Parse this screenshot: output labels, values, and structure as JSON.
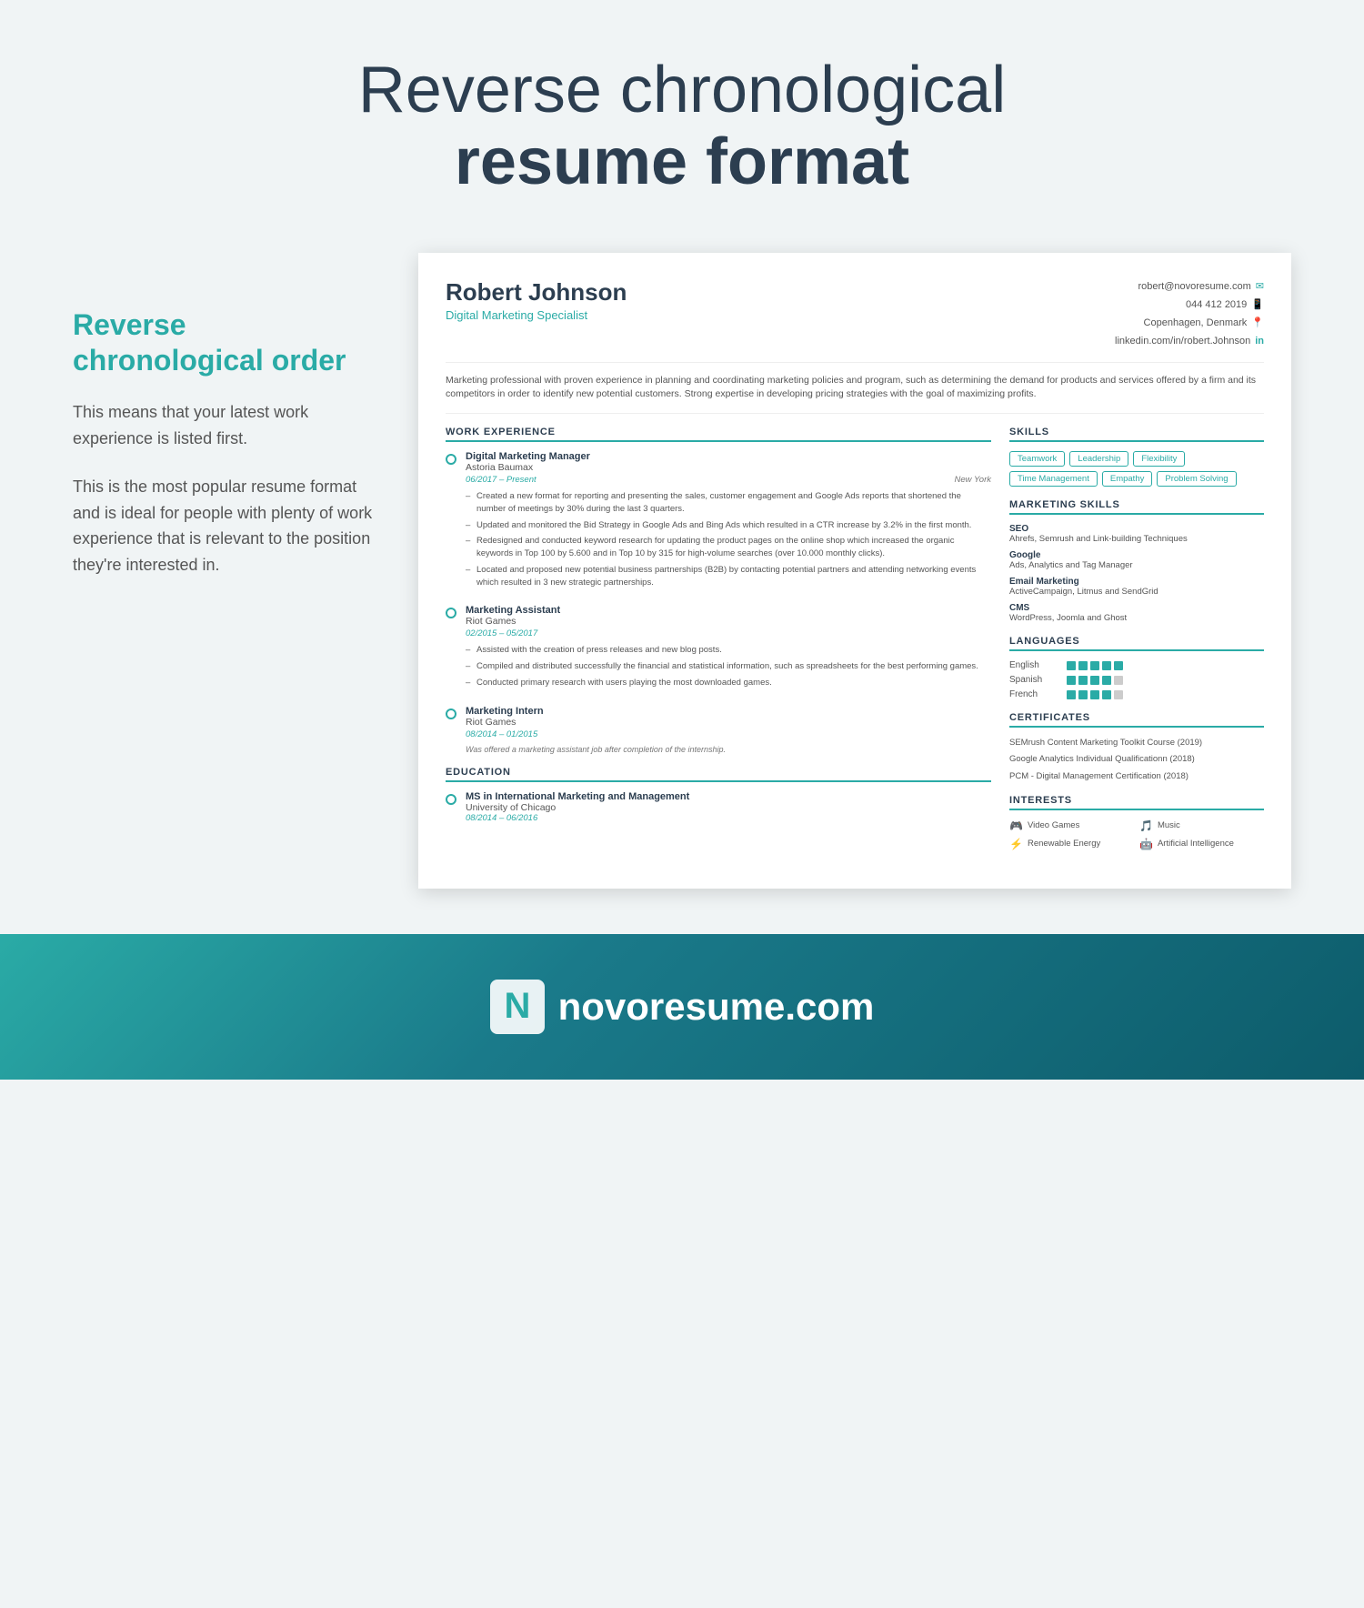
{
  "page": {
    "title_line1": "Reverse chronological",
    "title_line2": "resume format"
  },
  "left_panel": {
    "heading": "Reverse chronological order",
    "para1": "This means that your latest work experience is listed first.",
    "para2": "This is the most popular resume format and is ideal for people with plenty of work experience that is relevant to the position they're interested in."
  },
  "resume": {
    "name": "Robert Johnson",
    "title": "Digital Marketing Specialist",
    "contact": {
      "email": "robert@novoresume.com",
      "phone": "044 412 2019",
      "location": "Copenhagen, Denmark",
      "linkedin": "linkedin.com/in/robert.Johnson"
    },
    "summary": "Marketing professional with proven experience in planning and coordinating marketing policies and program, such as determining the demand for products and services offered by a firm and its competitors in order to identify new potential customers. Strong expertise in developing pricing strategies with the goal of maximizing profits.",
    "work_experience_title": "WORK EXPERIENCE",
    "jobs": [
      {
        "title": "Digital Marketing Manager",
        "company": "Astoria Baumax",
        "date_range": "06/2017 – Present",
        "location": "New York",
        "bullets": [
          "Created a new format for reporting and presenting the sales, customer engagement and Google Ads reports that shortened the number of meetings by 30% during the last 3 quarters.",
          "Updated and monitored the Bid Strategy in Google Ads and Bing Ads which resulted in a CTR increase by 3.2% in the first month.",
          "Redesigned and conducted keyword research for updating the product pages on the online shop which increased the organic keywords in Top 100 by 5.600 and in Top 10 by 315 for high-volume searches (over 10.000 monthly clicks).",
          "Located and proposed new potential business partnerships (B2B) by contacting potential partners and attending networking events which resulted in 3 new strategic partnerships."
        ]
      },
      {
        "title": "Marketing Assistant",
        "company": "Riot Games",
        "date_range": "02/2015 – 05/2017",
        "location": "",
        "bullets": [
          "Assisted with the creation of press releases and new blog posts.",
          "Compiled and distributed successfully the financial and statistical information, such as spreadsheets for the best performing games.",
          "Conducted primary research with users playing the most downloaded games."
        ]
      },
      {
        "title": "Marketing Intern",
        "company": "Riot Games",
        "date_range": "08/2014 – 01/2015",
        "location": "",
        "note": "Was offered a marketing assistant job after completion of the internship.",
        "bullets": []
      }
    ],
    "education_title": "EDUCATION",
    "education": [
      {
        "degree": "MS in International Marketing and Management",
        "school": "University of Chicago",
        "dates": "08/2014 – 06/2016"
      }
    ],
    "skills_title": "SKILLS",
    "skill_tags": [
      "Teamwork",
      "Leadership",
      "Flexibility",
      "Time Management",
      "Empathy",
      "Problem Solving"
    ],
    "marketing_skills_title": "MARKETING SKILLS",
    "marketing_skills": [
      {
        "name": "SEO",
        "desc": "Ahrefs, Semrush and Link-building Techniques"
      },
      {
        "name": "Google",
        "desc": "Ads, Analytics and Tag Manager"
      },
      {
        "name": "Email Marketing",
        "desc": "ActiveCampaign, Litmus and SendGrid"
      },
      {
        "name": "CMS",
        "desc": "WordPress, Joomla and Ghost"
      }
    ],
    "languages_title": "LANGUAGES",
    "languages": [
      {
        "name": "English",
        "level": 5
      },
      {
        "name": "Spanish",
        "level": 4
      },
      {
        "name": "French",
        "level": 4
      }
    ],
    "certificates_title": "CERTIFICATES",
    "certificates": [
      "SEMrush Content Marketing Toolkit Course (2019)",
      "Google Analytics Individual Qualificationn (2018)",
      "PCM - Digital Management Certification (2018)"
    ],
    "interests_title": "INTERESTS",
    "interests": [
      {
        "icon": "🎮",
        "label": "Video Games"
      },
      {
        "icon": "🎵",
        "label": "Music"
      },
      {
        "icon": "⚡",
        "label": "Renewable Energy"
      },
      {
        "icon": "🤖",
        "label": "Artificial Intelligence"
      }
    ]
  },
  "footer": {
    "brand": "novoresume.com"
  }
}
